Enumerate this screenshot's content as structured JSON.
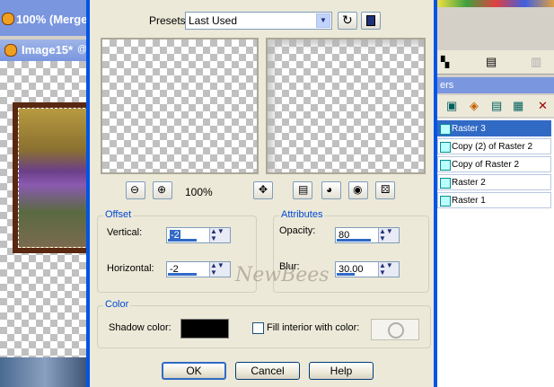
{
  "background": {
    "main_title": "100% (Merged",
    "doc_title": "Image15*",
    "doc_title_suffix": "@"
  },
  "layers": {
    "header": "ers",
    "items": [
      "Raster 3",
      "Copy (2) of Raster 2",
      "Copy of Raster 2",
      "Raster 2",
      "Raster 1"
    ],
    "selected_index": 0
  },
  "dialog": {
    "presets_label": "Presets:",
    "presets_value": "Last Used",
    "zoom_level": "100%",
    "offset": {
      "title": "Offset",
      "vertical_label": "Vertical:",
      "vertical_value": "-2",
      "horizontal_label": "Horizontal:",
      "horizontal_value": "-2"
    },
    "attributes": {
      "title": "Attributes",
      "opacity_label": "Opacity:",
      "opacity_value": "80",
      "blur_label": "Blur:",
      "blur_value": "30.00"
    },
    "color": {
      "title": "Color",
      "shadow_color_label": "Shadow color:",
      "shadow_color": "#000000",
      "fill_interior_label": "Fill interior with color:",
      "fill_interior_checked": false
    },
    "buttons": {
      "ok": "OK",
      "cancel": "Cancel",
      "help": "Help"
    },
    "watermark": "NewBees"
  },
  "colors": {
    "accent": "#316ac5",
    "group_title": "#0046d5",
    "dialog_bg": "#ece9d8"
  }
}
